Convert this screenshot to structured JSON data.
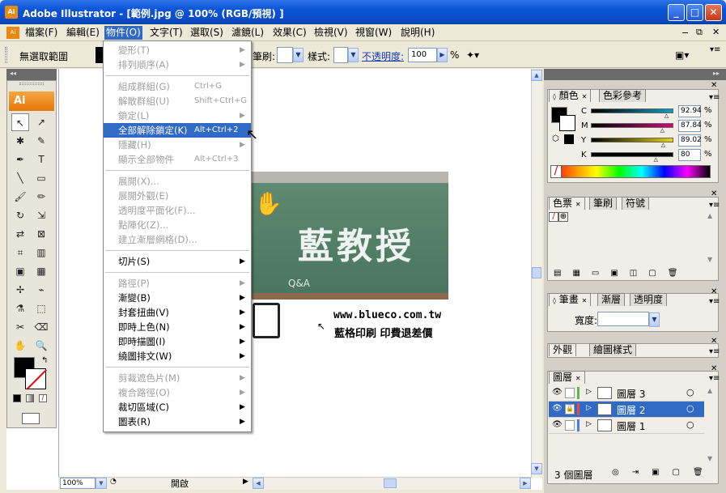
{
  "window": {
    "title": "Adobe Illustrator - [範例.jpg @ 100% (RGB/預視) ]",
    "app_icon": "Ai"
  },
  "menubar": {
    "items": [
      "檔案(F)",
      "編輯(E)",
      "物件(O)",
      "文字(T)",
      "選取(S)",
      "濾鏡(L)",
      "效果(C)",
      "檢視(V)",
      "視窗(W)",
      "說明(H)"
    ],
    "active_index": 2
  },
  "control_bar": {
    "no_selection": "無選取範圍",
    "stroke_label": "筆刷:",
    "style_label": "樣式:",
    "opacity_label": "不透明度:",
    "opacity_value": "100",
    "opacity_unit": "%"
  },
  "object_menu": [
    {
      "label": "變形(T)",
      "arrow": true,
      "disabled": true
    },
    {
      "label": "排列順序(A)",
      "arrow": true,
      "disabled": true
    },
    {
      "sep": true
    },
    {
      "label": "組成群組(G)",
      "shortcut": "Ctrl+G",
      "disabled": true
    },
    {
      "label": "解散群組(U)",
      "shortcut": "Shift+Ctrl+G",
      "disabled": true
    },
    {
      "label": "鎖定(L)",
      "arrow": true,
      "disabled": true
    },
    {
      "label": "全部解除鎖定(K)",
      "shortcut": "Alt+Ctrl+2",
      "highlighted": true
    },
    {
      "label": "隱藏(H)",
      "arrow": true,
      "disabled": true
    },
    {
      "label": "顯示全部物件",
      "shortcut": "Alt+Ctrl+3",
      "disabled": true
    },
    {
      "sep": true
    },
    {
      "label": "展開(X)...",
      "disabled": true
    },
    {
      "label": "展開外觀(E)",
      "disabled": true
    },
    {
      "label": "透明度平面化(F)...",
      "disabled": true
    },
    {
      "label": "點陣化(Z)...",
      "disabled": true
    },
    {
      "label": "建立漸層網格(D)...",
      "disabled": true
    },
    {
      "sep": true
    },
    {
      "label": "切片(S)",
      "arrow": true
    },
    {
      "sep": true
    },
    {
      "label": "路徑(P)",
      "arrow": true,
      "disabled": true
    },
    {
      "label": "漸變(B)",
      "arrow": true
    },
    {
      "label": "封套扭曲(V)",
      "arrow": true
    },
    {
      "label": "即時上色(N)",
      "arrow": true
    },
    {
      "label": "即時描圖(I)",
      "arrow": true
    },
    {
      "label": "繞圖排文(W)",
      "arrow": true
    },
    {
      "sep": true
    },
    {
      "label": "剪裁遮色片(M)",
      "arrow": true,
      "disabled": true
    },
    {
      "label": "複合路徑(O)",
      "arrow": true,
      "disabled": true
    },
    {
      "label": "裁切區域(C)",
      "arrow": true
    },
    {
      "label": "圖表(R)",
      "arrow": true
    }
  ],
  "artwork": {
    "title": "藍教授",
    "qa": "Q&A",
    "url": "www.blueco.com.tw",
    "slogan": "藍格印刷 印費退差價"
  },
  "color_panel": {
    "tabs": [
      "顏色",
      "色彩參考"
    ],
    "channels": [
      {
        "name": "C",
        "value": "92.94",
        "unit": "%",
        "color": "#00A0C6"
      },
      {
        "name": "M",
        "value": "87.84",
        "unit": "%",
        "color": "#D6007E"
      },
      {
        "name": "Y",
        "value": "89.02",
        "unit": "%",
        "color": "#E8D400"
      },
      {
        "name": "K",
        "value": "80",
        "unit": "%",
        "color": "#000000"
      }
    ]
  },
  "swatch_panel": {
    "tabs": [
      "色票",
      "筆刷",
      "符號"
    ]
  },
  "stroke_panel": {
    "tabs": [
      "筆畫",
      "漸層",
      "透明度"
    ],
    "width_label": "寬度:"
  },
  "appearance_panel": {
    "tabs": [
      "外觀",
      "繪圖樣式"
    ]
  },
  "layers_panel": {
    "tab": "圖層",
    "layers": [
      {
        "name": "圖層 3",
        "color": "#5BB84F",
        "locked": false,
        "selected": false
      },
      {
        "name": "圖層 2",
        "color": "#E84848",
        "locked": true,
        "selected": true
      },
      {
        "name": "圖層 1",
        "color": "#4D7BE8",
        "locked": false,
        "selected": false
      }
    ],
    "count_label": "3 個圖層"
  },
  "statusbar": {
    "zoom": "100%",
    "status": "開啟"
  }
}
